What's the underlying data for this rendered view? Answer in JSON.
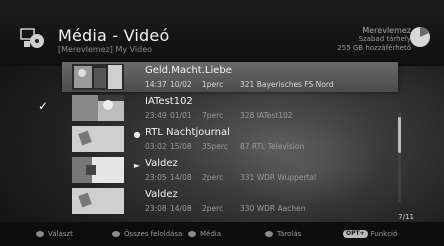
{
  "header": {
    "title": "Média - Videó",
    "breadcrumb": "[Merevlemez] My Video",
    "storage_name": "Merevlemez",
    "free_space_label": "Szabad tárhely",
    "free_space_value": "255 GB hozzáférhető"
  },
  "recordings": [
    {
      "title": "Geld.Macht.Liebe",
      "time": "14:37",
      "date": "10/02",
      "duration": "1perc",
      "channel": "321 Bayerisches FS Nord",
      "selected": true,
      "mark": ""
    },
    {
      "title": "IATest102",
      "time": "23:49",
      "date": "01/01",
      "duration": "7perc",
      "channel": "328 IATest102",
      "selected": false,
      "mark": "check"
    },
    {
      "title": "RTL Nachtjournal",
      "time": "03:02",
      "date": "15/08",
      "duration": "35perc",
      "channel": "87 RTL Television",
      "selected": false,
      "mark": "dot"
    },
    {
      "title": "Valdez",
      "time": "23:05",
      "date": "14/08",
      "duration": "2perc",
      "channel": "331 WDR Wuppertal",
      "selected": false,
      "mark": "play"
    },
    {
      "title": "Valdez",
      "time": "23:08",
      "date": "14/08",
      "duration": "2perc",
      "channel": "330 WDR Aachen",
      "selected": false,
      "mark": ""
    }
  ],
  "marks": {
    "check": "✓",
    "dot": "●",
    "play": "►"
  },
  "page_count": "7/11",
  "scroll_position": 0.1,
  "footer": {
    "select_label": "Választ",
    "unlock_all_label": "Összes feloldása",
    "media_label": "Média",
    "storage_label": "Tárolás",
    "opt_badge": "OPT+",
    "function_label": "Funkció"
  },
  "colors": {
    "selected_row": "#5e5e5e",
    "background": "#1a1a1a",
    "footer_dot": "#8a8a8a"
  },
  "icons": [
    "media-library-icon",
    "disk-usage-icon",
    "checkmark-icon",
    "dot-icon",
    "play-icon"
  ]
}
